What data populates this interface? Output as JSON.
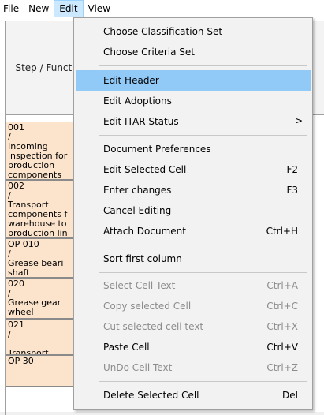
{
  "menubar": {
    "items": [
      {
        "label": "File"
      },
      {
        "label": "New"
      },
      {
        "label": "Edit"
      },
      {
        "label": "View"
      }
    ]
  },
  "grid": {
    "header_label": "Step / Function",
    "rows": [
      {
        "lines": [
          "001",
          "/",
          "Incoming",
          "inspection for",
          "production",
          "components"
        ]
      },
      {
        "lines": [
          "002",
          "/",
          "Transport",
          "components f",
          "warehouse to",
          "production lin"
        ]
      },
      {
        "lines": [
          "OP 010",
          "/",
          "Grease beari",
          "shaft"
        ]
      },
      {
        "lines": [
          "020",
          "/",
          "Grease gear",
          "wheel"
        ]
      },
      {
        "lines": [
          "021",
          "/",
          "Transport"
        ]
      },
      {
        "lines": [
          "OP 30"
        ]
      }
    ]
  },
  "edit_menu": {
    "items": [
      {
        "label": "Choose Classification Set",
        "shortcut": "",
        "disabled": false
      },
      {
        "label": "Choose Criteria Set",
        "shortcut": "",
        "disabled": false
      },
      {
        "label": "Edit Header",
        "shortcut": "",
        "disabled": false,
        "highlighted": true
      },
      {
        "label": "Edit Adoptions",
        "shortcut": "",
        "disabled": false
      },
      {
        "label": "Edit ITAR Status",
        "shortcut": "",
        "disabled": false,
        "submenu_arrow": ">"
      },
      {
        "label": "Document Preferences",
        "shortcut": "",
        "disabled": false
      },
      {
        "label": "Edit Selected Cell",
        "shortcut": "F2",
        "disabled": false
      },
      {
        "label": "Enter changes",
        "shortcut": "F3",
        "disabled": false
      },
      {
        "label": "Cancel Editing",
        "shortcut": "",
        "disabled": false
      },
      {
        "label": "Attach Document",
        "shortcut": "Ctrl+H",
        "disabled": false
      },
      {
        "label": "Sort first column",
        "shortcut": "",
        "disabled": false
      },
      {
        "label": "Select Cell Text",
        "shortcut": "Ctrl+A",
        "disabled": true
      },
      {
        "label": "Copy selected Cell",
        "shortcut": "Ctrl+C",
        "disabled": true
      },
      {
        "label": "Cut selected cell text",
        "shortcut": "Ctrl+X",
        "disabled": true
      },
      {
        "label": "Paste Cell",
        "shortcut": "Ctrl+V",
        "disabled": false
      },
      {
        "label": "UnDo Cell Text",
        "shortcut": "Ctrl+Z",
        "disabled": true
      },
      {
        "label": "Delete Selected Cell",
        "shortcut": "Del",
        "disabled": false
      }
    ]
  },
  "colors": {
    "highlight": "#91c9f7",
    "cell_bg": "#fce4cc",
    "menu_bg": "#f2f2f2",
    "disabled_text": "#8c8c8c"
  }
}
